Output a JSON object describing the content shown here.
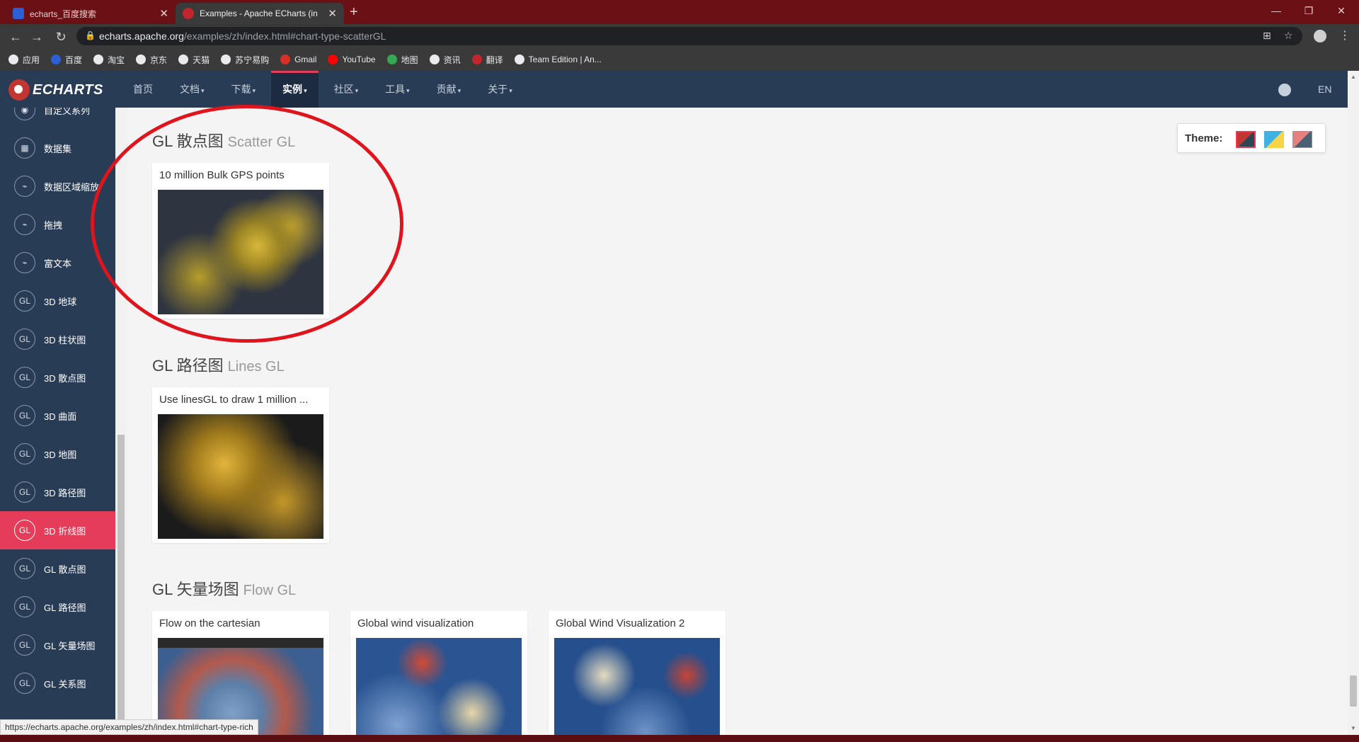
{
  "browser": {
    "tabs": [
      {
        "title": "echarts_百度搜索"
      },
      {
        "title": "Examples - Apache ECharts (in"
      }
    ],
    "url_host": "echarts.apache.org",
    "url_path": "/examples/zh/index.html#chart-type-scatterGL",
    "bookmarks": [
      {
        "label": "应用",
        "icon": "apps-grid-icon",
        "color": "#e8eaed"
      },
      {
        "label": "百度",
        "icon": "baidu-icon",
        "color": "#2c5fd6"
      },
      {
        "label": "淘宝",
        "icon": "globe-icon",
        "color": "#e8eaed"
      },
      {
        "label": "京东",
        "icon": "globe-icon",
        "color": "#e8eaed"
      },
      {
        "label": "天猫",
        "icon": "globe-icon",
        "color": "#e8eaed"
      },
      {
        "label": "苏宁易购",
        "icon": "globe-icon",
        "color": "#e8eaed"
      },
      {
        "label": "Gmail",
        "icon": "gmail-icon",
        "color": "#d93025"
      },
      {
        "label": "YouTube",
        "icon": "youtube-icon",
        "color": "#ff0000"
      },
      {
        "label": "地图",
        "icon": "maps-icon",
        "color": "#34a853"
      },
      {
        "label": "资讯",
        "icon": "globe-icon",
        "color": "#e8eaed"
      },
      {
        "label": "翻译",
        "icon": "yahoo-icon",
        "color": "#c2252c"
      },
      {
        "label": "Team Edition | An...",
        "icon": "globe-icon",
        "color": "#e8eaed"
      }
    ],
    "status_url": "https://echarts.apache.org/examples/zh/index.html#chart-type-rich"
  },
  "site": {
    "logo": "ECHARTS",
    "nav": [
      "首页",
      "文档",
      "下载",
      "实例",
      "社区",
      "工具",
      "贡献",
      "关于"
    ],
    "nav_active": "实例",
    "lang": "EN"
  },
  "sidebar": {
    "items": [
      {
        "icon": "◉",
        "label": "自定义系列"
      },
      {
        "icon": "▦",
        "label": "数据集"
      },
      {
        "icon": "⌁",
        "label": "数据区域缩放"
      },
      {
        "icon": "⌁",
        "label": "拖拽"
      },
      {
        "icon": "⌁",
        "label": "富文本"
      },
      {
        "icon": "GL",
        "label": "3D 地球"
      },
      {
        "icon": "GL",
        "label": "3D 柱状图"
      },
      {
        "icon": "GL",
        "label": "3D 散点图"
      },
      {
        "icon": "GL",
        "label": "3D 曲面"
      },
      {
        "icon": "GL",
        "label": "3D 地图"
      },
      {
        "icon": "GL",
        "label": "3D 路径图"
      },
      {
        "icon": "GL",
        "label": "3D 折线图"
      },
      {
        "icon": "GL",
        "label": "GL 散点图"
      },
      {
        "icon": "GL",
        "label": "GL 路径图"
      },
      {
        "icon": "GL",
        "label": "GL 矢量场图"
      },
      {
        "icon": "GL",
        "label": "GL 关系图"
      }
    ],
    "active": "3D 折线图"
  },
  "sections": [
    {
      "title": "GL 散点图",
      "subtitle": "Scatter GL",
      "cards": [
        {
          "title": "10 million Bulk GPS points"
        }
      ]
    },
    {
      "title": "GL 路径图",
      "subtitle": "Lines GL",
      "cards": [
        {
          "title": "Use linesGL to draw 1 million ..."
        }
      ]
    },
    {
      "title": "GL 矢量场图",
      "subtitle": "Flow GL",
      "cards": [
        {
          "title": "Flow on the cartesian"
        },
        {
          "title": "Global wind visualization"
        },
        {
          "title": "Global Wind Visualization 2"
        }
      ]
    }
  ],
  "theme": {
    "label": "Theme:",
    "swatches": [
      {
        "name": "default",
        "colors": [
          "#c23531",
          "#2f4554"
        ]
      },
      {
        "name": "light",
        "colors": [
          "#3fb1e3",
          "#f5d547"
        ]
      },
      {
        "name": "dark",
        "colors": [
          "#e77f7f",
          "#4b6072"
        ]
      }
    ]
  }
}
